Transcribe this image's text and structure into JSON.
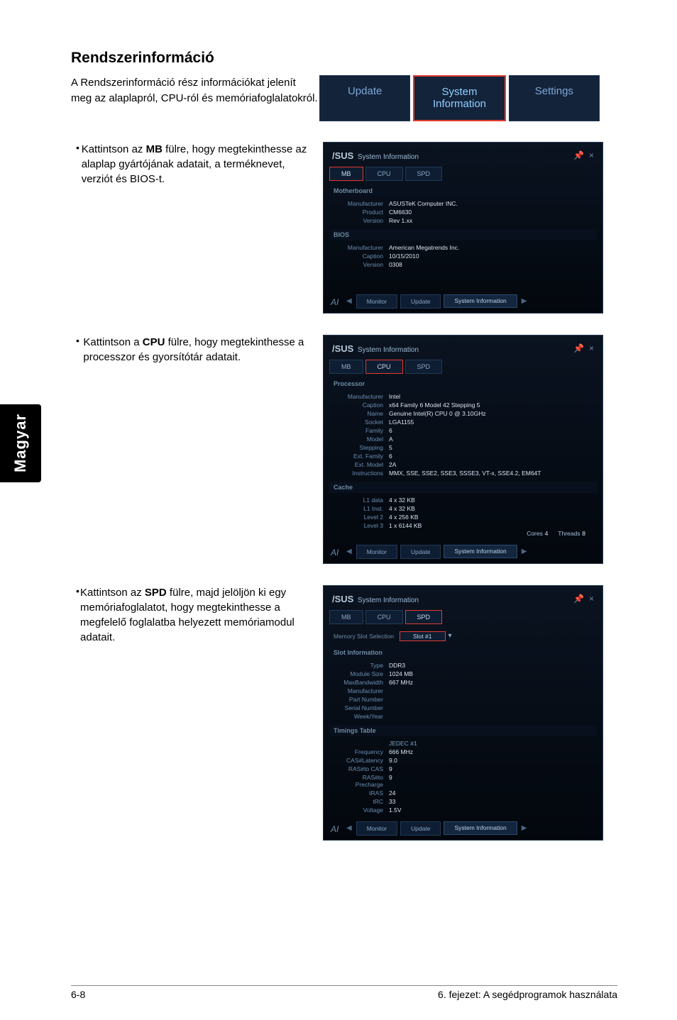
{
  "sidebar": {
    "label": "Magyar"
  },
  "heading": "Rendszerinformáció",
  "intro": "A Rendszerinformáció rész információkat jelenít meg az alaplapról, CPU-ról és memóriafoglalatokról.",
  "top_tabs": {
    "update": "Update",
    "sysinfo1": "System",
    "sysinfo2": "Information",
    "settings": "Settings"
  },
  "bullets": {
    "mb": {
      "pre": "Kattintson az ",
      "bold": "MB",
      "post": " fülre, hogy megtekinthesse az alaplap gyártójának adatait, a terméknevet, verziót és BIOS-t."
    },
    "cpu": {
      "pre": "Kattintson a ",
      "bold": "CPU",
      "post": " fülre, hogy megtekinthesse a processzor és gyorsítótár adatait."
    },
    "spd": {
      "pre": "Kattintson az ",
      "bold": "SPD",
      "post": " fülre, majd jelöljön ki egy memóriafoglalatot, hogy megtekinthesse a megfelelő foglalatba helyezett memóriamodul adatait."
    }
  },
  "shot_common": {
    "brand": "/SUS",
    "title": "System Information",
    "pin": "📌",
    "close": "×",
    "tab_mb": "MB",
    "tab_cpu": "CPU",
    "tab_spd": "SPD",
    "nav_monitor": "Monitor",
    "nav_update": "Update",
    "nav_sysinfo": "System Information",
    "tri_left": "◀",
    "tri_right": "▶",
    "logo": "AI"
  },
  "shot_mb": {
    "sect1": "Motherboard",
    "k1": "Manufacturer",
    "v1": "ASUSTeK Computer INC.",
    "k2": "Product",
    "v2": "CM6630",
    "k3": "Version",
    "v3": "Rev 1.xx",
    "sect2": "BIOS",
    "k4": "Manufacturer",
    "v4": "American Megatrends Inc.",
    "k5": "Caption",
    "v5": "10/15/2010",
    "k6": "Version",
    "v6": "0308"
  },
  "shot_cpu": {
    "sect1": "Processor",
    "k1": "Manufacturer",
    "v1": "Intel",
    "k2": "Caption",
    "v2": "x64 Family 6 Model 42 Stepping 5",
    "k3": "Name",
    "v3": "Genuine Intel(R) CPU 0 @ 3.10GHz",
    "k4": "Socket",
    "v4": "LGA1155",
    "k5": "Family",
    "v5": "6",
    "k6": "Model",
    "v6": "A",
    "k7": "Stepping",
    "v7": "5",
    "k8": "Ext. Family",
    "v8": "6",
    "k9": "Ext. Model",
    "v9": "2A",
    "k10": "Instructions",
    "v10": "MMX, SSE, SSE2, SSE3, SSSE3, VT-x, SSE4.2, EM64T",
    "sect2": "Cache",
    "k11": "L1 data",
    "v11": "4 x 32 KB",
    "k12": "L1 Inst.",
    "v12": "4 x 32 KB",
    "k13": "Level 2",
    "v13": "4 x 256 KB",
    "k14": "Level 3",
    "v14": "1 x 6144 KB",
    "cores_l": "Cores",
    "cores_v": "4",
    "threads_l": "Threads",
    "threads_v": "8"
  },
  "shot_spd": {
    "memsel_l": "Memory Slot Selection",
    "memsel_v": "Slot #1",
    "sect1": "Slot Information",
    "k1": "Type",
    "v1": "DDR3",
    "k2": "Module Size",
    "v2": "1024 MB",
    "k3": "MaxBandwidth",
    "v3": "667 MHz",
    "k4": "Manufacturer",
    "v4": "",
    "k5": "Part Number",
    "v5": "",
    "k6": "Serial Number",
    "v6": "",
    "k7": "Week/Year",
    "v7": "",
    "sect2": "Timings Table",
    "h1": "JEDEC #1",
    "k8": "Frequency",
    "v8": "666 MHz",
    "k9": "CAS#Latency",
    "v9": "9.0",
    "k10": "RAS#to CAS",
    "v10": "9",
    "k11": "RAS#to Precharge",
    "v11": "9",
    "k12": "tRAS",
    "v12": "24",
    "k13": "tRC",
    "v13": "33",
    "k14": "Voltage",
    "v14": "1.5V"
  },
  "footer": {
    "left": "6-8",
    "right": "6. fejezet: A segédprogramok használata"
  }
}
